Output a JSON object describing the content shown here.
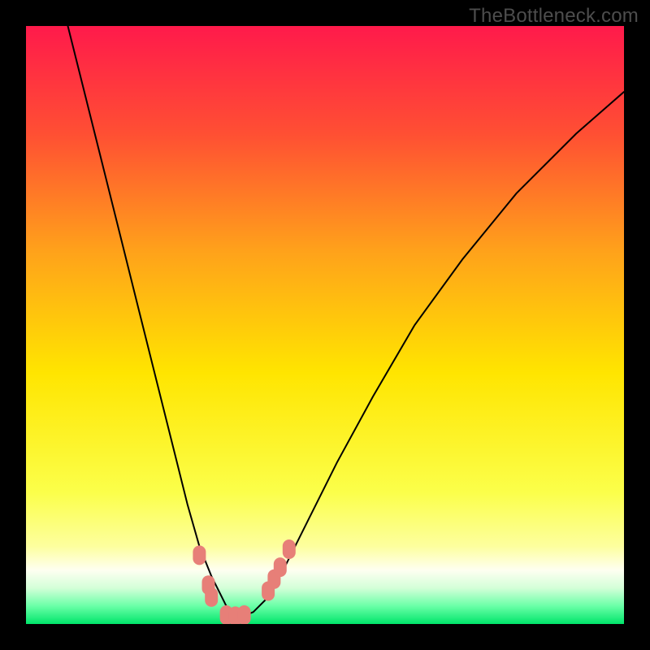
{
  "watermark": "TheBottleneck.com",
  "colors": {
    "frame": "#000000",
    "gradient_top": "#ff1a4b",
    "gradient_upper_mid": "#ff7b1e",
    "gradient_mid": "#ffe500",
    "gradient_lower_mid": "#f8ff7a",
    "gradient_band_pale": "#fdffd6",
    "gradient_bottom": "#00e56a",
    "curve": "#000000",
    "marker": "#e77f78"
  },
  "chart_data": {
    "type": "line",
    "title": "",
    "xlabel": "",
    "ylabel": "",
    "xlim": [
      0,
      100
    ],
    "ylim": [
      0,
      100
    ],
    "series": [
      {
        "name": "bottleneck-curve",
        "x": [
          7,
          10,
          13,
          16,
          19,
          22,
          25,
          27,
          29,
          31,
          33,
          34,
          35,
          36,
          38,
          40,
          43,
          47,
          52,
          58,
          65,
          73,
          82,
          92,
          100
        ],
        "y": [
          100,
          88,
          76,
          64,
          52,
          40,
          28,
          20,
          13,
          8,
          4,
          2,
          1.2,
          1.2,
          2,
          4,
          9,
          17,
          27,
          38,
          50,
          61,
          72,
          82,
          89
        ]
      }
    ],
    "markers": [
      {
        "x": 29.0,
        "y": 11.5
      },
      {
        "x": 30.5,
        "y": 6.5
      },
      {
        "x": 31.0,
        "y": 4.5
      },
      {
        "x": 33.5,
        "y": 1.5
      },
      {
        "x": 35.0,
        "y": 1.3
      },
      {
        "x": 36.5,
        "y": 1.5
      },
      {
        "x": 40.5,
        "y": 5.5
      },
      {
        "x": 41.5,
        "y": 7.5
      },
      {
        "x": 42.5,
        "y": 9.5
      },
      {
        "x": 44.0,
        "y": 12.5
      }
    ],
    "legend": false,
    "grid": false,
    "notes": "Background is a vertical color gradient from red (top) to green (bottom); y-value visually encodes bottleneck severity (lower = better). A single black curve descends steeply from the top-left, reaches a minimum near x≈35, and climbs more gradually toward the upper-right. Salmon-colored rounded markers sit along the curve near its minimum."
  }
}
